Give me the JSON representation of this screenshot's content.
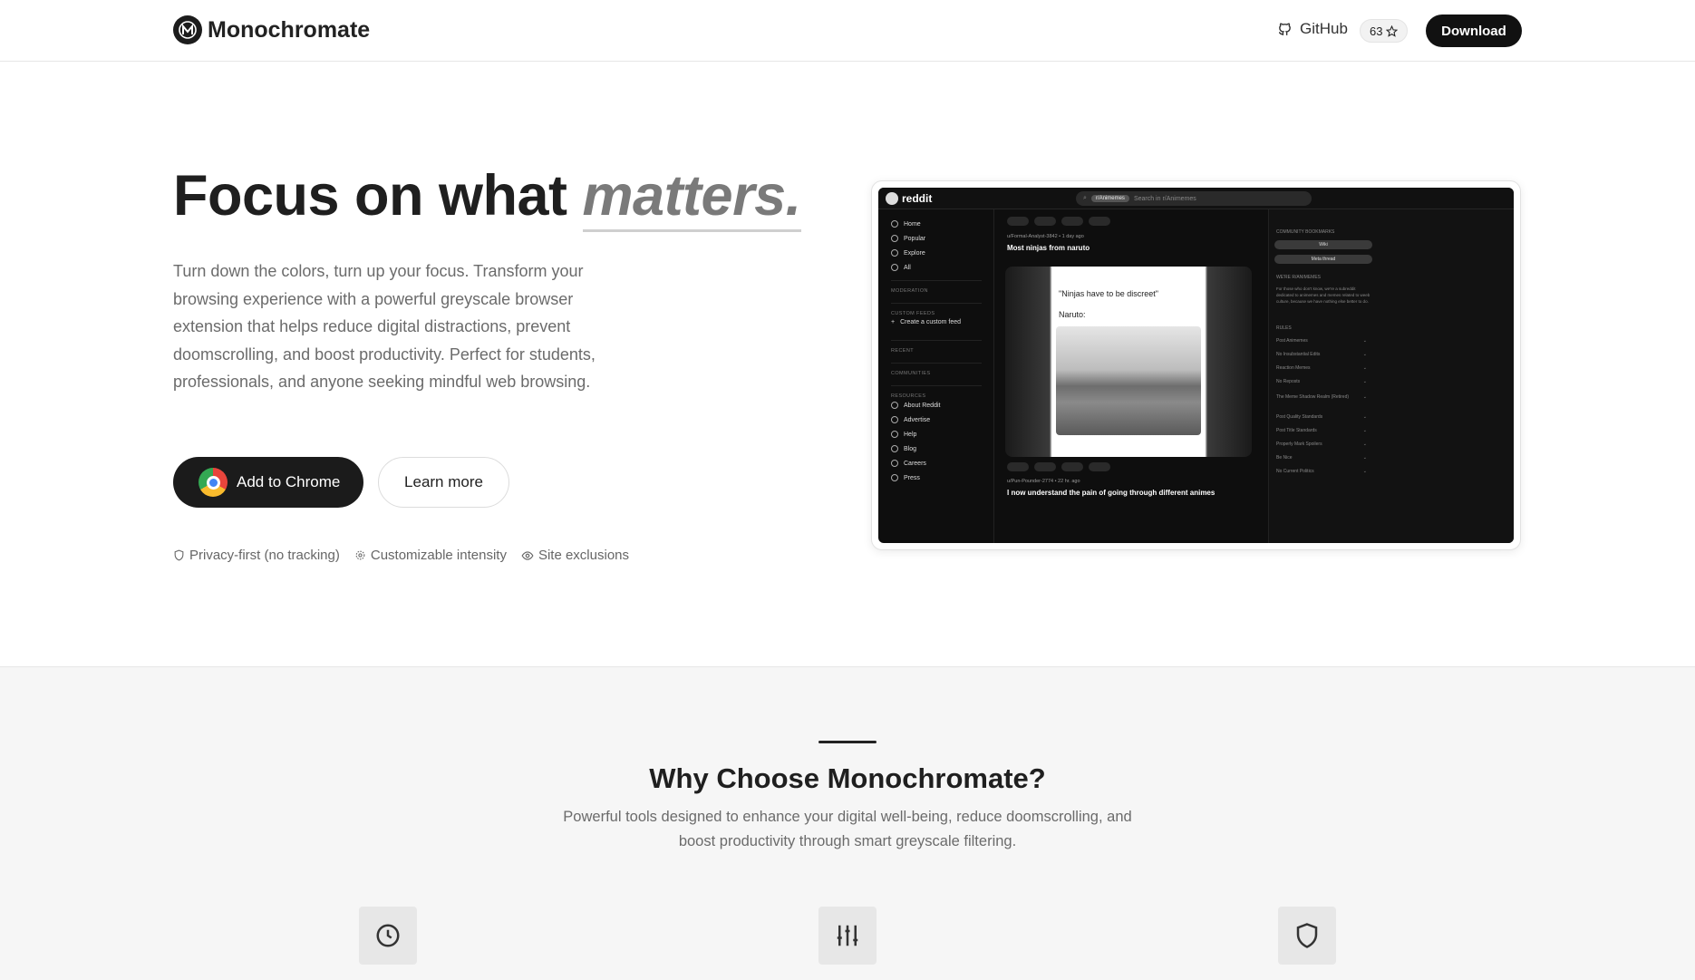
{
  "nav": {
    "brand": "Monochromate",
    "github_label": "GitHub",
    "stars": "63",
    "download_label": "Download"
  },
  "hero": {
    "title_main": "Focus on what",
    "title_emphasis": "matters.",
    "description": "Turn down the colors, turn up your focus. Transform your browsing experience with a powerful greyscale browser extension that helps reduce digital distractions, prevent doomscrolling, and boost productivity. Perfect for students, professionals, and anyone seeking mindful web browsing.",
    "primary_cta": "Add to Chrome",
    "secondary_cta": "Learn more",
    "features": [
      "Privacy-first (no tracking)",
      "Customizable intensity",
      "Site exclusions"
    ]
  },
  "preview": {
    "brand": "reddit",
    "subreddit_chip": "r/Animemes",
    "search_placeholder": "Search in r/Animemes",
    "nav": [
      "Home",
      "Popular",
      "Explore",
      "All"
    ],
    "sections": [
      "MODERATION",
      "CUSTOM FEEDS",
      "RECENT",
      "COMMUNITIES",
      "RESOURCES"
    ],
    "create_feed": "Create a custom feed",
    "resources": [
      "About Reddit",
      "Advertise",
      "Help",
      "Blog",
      "Careers",
      "Press"
    ],
    "post1_user": "u/Formal-Analyst-3842 • 1 day ago",
    "post1_title": "Most ninjas from naruto",
    "card_line1": "\"Ninjas have to be discreet\"",
    "card_line2": "Naruto:",
    "post2_user": "u/Pun-Pounder-2774 • 22 hr. ago",
    "post2_title": "I now understand the pain of going through different animes",
    "sidebar_heading": "COMMUNITY BOOKMARKS",
    "bookmarks": [
      "Wiki",
      "Meta thread"
    ],
    "about_heading": "WE'RE R/ANIMEMES",
    "about_text": "For those who don't know, we're a subreddit dedicated to animemes and memes related to weeb culture, because we have nothing else better to do.",
    "rules_heading": "RULES",
    "rules": [
      "Post Animemes",
      "No Insubstantial Edits",
      "Reaction Memes",
      "No Reposts",
      "The Meme Shadow Realm (Retired)",
      "Post Quality Standards",
      "Post Title Standards",
      "Properly Mark Spoilers",
      "Be Nice",
      "No Current Politics"
    ]
  },
  "why": {
    "title": "Why Choose Monochromate?",
    "subtitle": "Powerful tools designed to enhance your digital well-being, reduce doomscrolling, and boost productivity through smart greyscale filtering.",
    "icons": [
      "clock-icon",
      "sliders-icon",
      "shield-icon"
    ]
  }
}
